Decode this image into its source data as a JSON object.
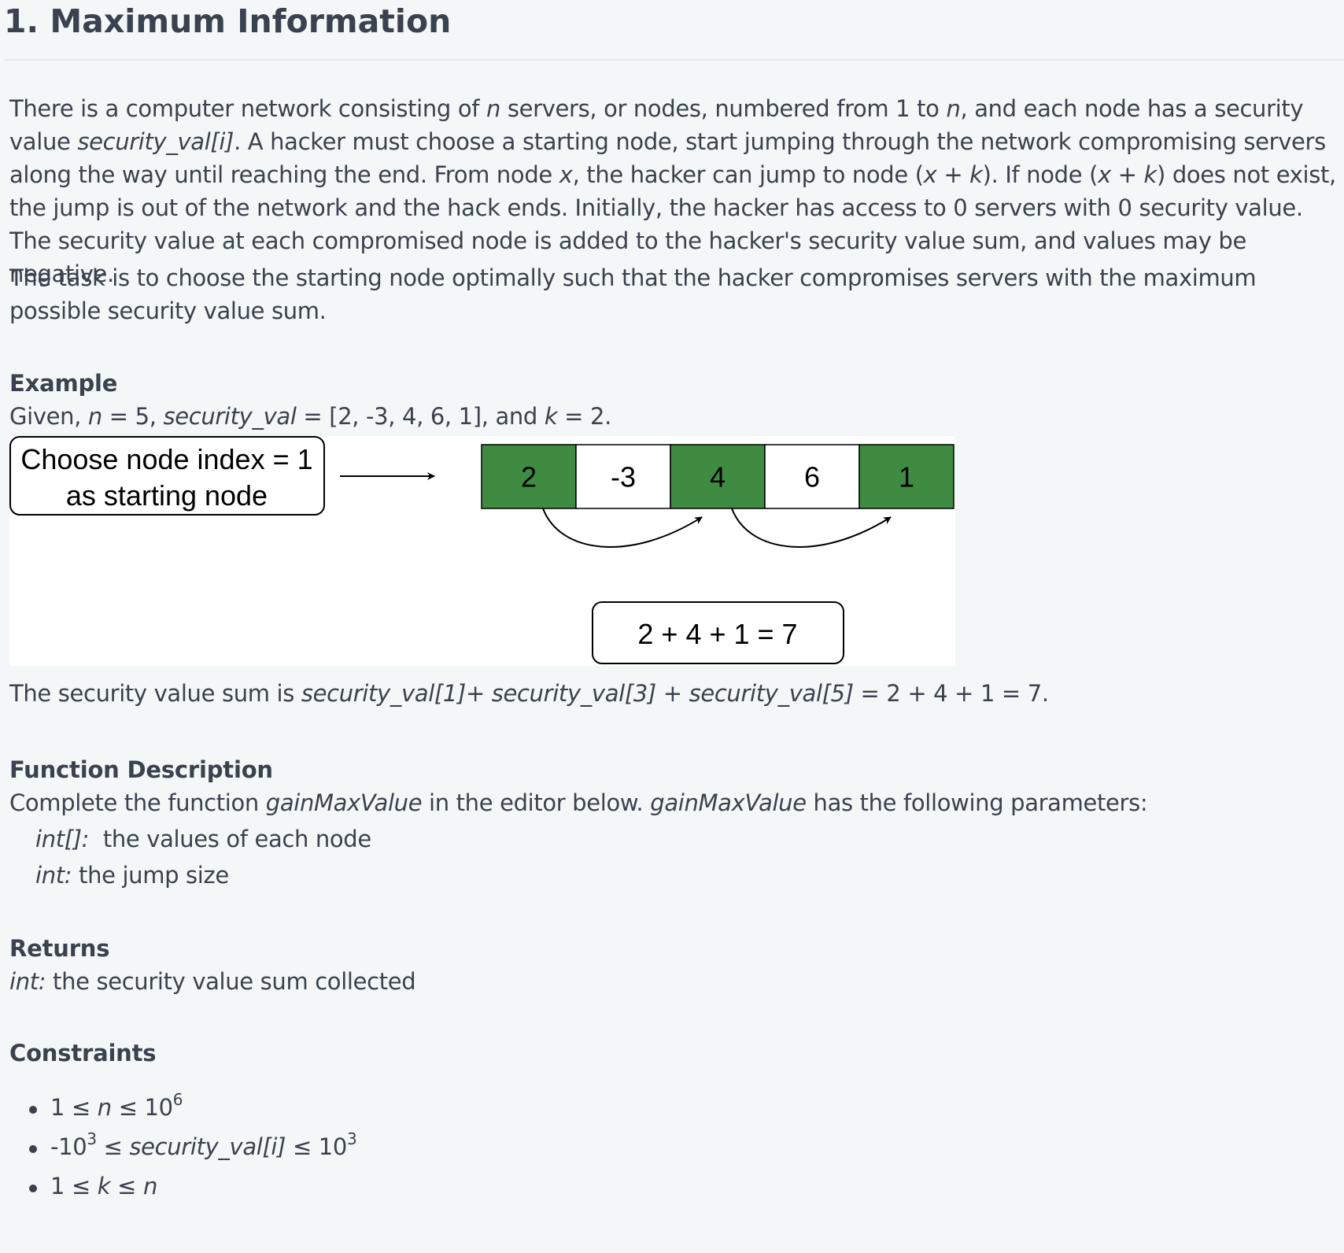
{
  "title": "1. Maximum Information",
  "description": {
    "p1": {
      "t1": "There is a computer network consisting of ",
      "n1": "n",
      "t2": " servers, or nodes, numbered from 1 to ",
      "n2": "n",
      "t3": ", and each node has a security value ",
      "arr": "security_val[i]",
      "t4": ". A hacker must choose a starting node, start jumping through the network compromising servers along the way until reaching the end. From node ",
      "x1": "x",
      "t5": ", the hacker can jump to node (",
      "xk1": "x + k",
      "t6": "). If node (",
      "xk2": "x + k",
      "t7": ") does not exist, the jump is out of the network and the hack ends. Initially, the hacker has access to 0 servers with 0 security value. The security value at each compromised node is added to the hacker's security value sum, and values may be negative."
    },
    "p2": "The task is to choose the starting node optimally such that the hacker compromises servers with the maximum possible security value sum."
  },
  "example": {
    "heading": "Example",
    "given": {
      "t1": "Given, ",
      "n": "n",
      "t2": " = 5, ",
      "arr": "security_val",
      "t3": " = [2, -3, 4, 6, 1], and ",
      "k": "k",
      "t4": " = 2."
    },
    "diagram": {
      "start_label_line1": "Choose node index = 1",
      "start_label_line2": "as starting node",
      "cells": [
        {
          "value": "2",
          "selected": true
        },
        {
          "value": "-3",
          "selected": false
        },
        {
          "value": "4",
          "selected": true
        },
        {
          "value": "6",
          "selected": false
        },
        {
          "value": "1",
          "selected": true
        }
      ],
      "sum_label": "2 + 4 + 1 = 7",
      "selected_color": "#3f8b41",
      "unselected_color": "#ffffff"
    },
    "explanation": {
      "t1": "The security value sum is ",
      "v1": "security_val[1]",
      "t2": "+ ",
      "v2": "security_val[3]",
      "t3": " + ",
      "v3": "security_val[5]",
      "t4": " = 2 + 4 + 1 = 7."
    }
  },
  "function_description": {
    "heading": "Function Description",
    "intro": {
      "t1": "Complete the function ",
      "fn1": "gainMaxValue",
      "t2": " in the editor below. ",
      "fn2": "gainMaxValue",
      "t3": " has the following parameters:"
    },
    "params": [
      {
        "type": "int[]:",
        "desc": "  the values of each node"
      },
      {
        "type": "int:",
        "desc": " the jump size"
      }
    ]
  },
  "returns": {
    "heading": "Returns",
    "type": "int:",
    "desc": " the security value sum collected"
  },
  "constraints": {
    "heading": "Constraints",
    "c1": {
      "a": "1 ≤ ",
      "b": "n",
      "c": " ≤ 10",
      "sup": "6"
    },
    "c2": {
      "a": "-10",
      "sup1": "3",
      "b": " ≤ ",
      "c": "security_val[i]",
      "d": " ≤ 10",
      "sup2": "3"
    },
    "c3": {
      "a": "1 ≤ ",
      "b": "k",
      "c": " ≤ ",
      "d": "n"
    }
  }
}
